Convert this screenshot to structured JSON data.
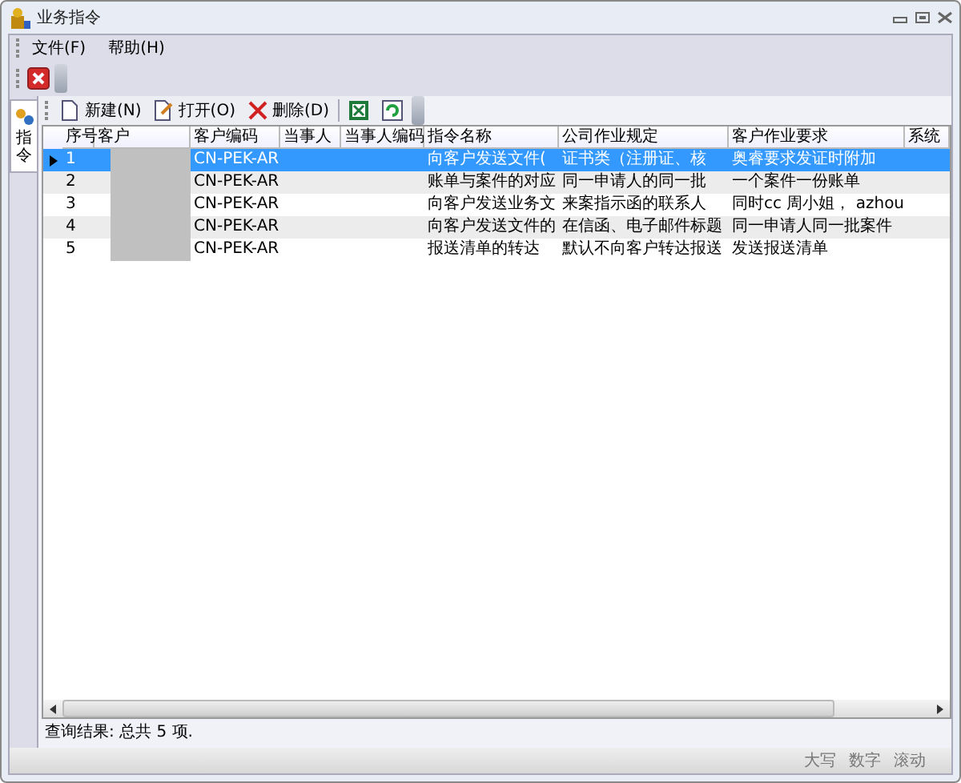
{
  "window": {
    "title": "业务指令"
  },
  "menu": [
    {
      "label": "文件(F)"
    },
    {
      "label": "帮助(H)"
    }
  ],
  "side_tab": {
    "label": "指令",
    "selected": true
  },
  "toolbar": [
    {
      "kind": "button",
      "label": "新建(N)"
    },
    {
      "kind": "button",
      "label": "打开(O)"
    },
    {
      "kind": "button",
      "label": "删除(D)"
    },
    {
      "kind": "separator"
    },
    {
      "kind": "icon_button"
    },
    {
      "kind": "icon_button"
    }
  ],
  "table": {
    "columns": [
      "序号",
      "客户",
      "客户编码",
      "当事人",
      "当事人编码",
      "指令名称",
      "公司作业规定",
      "客户作业要求",
      "系统"
    ],
    "rows": [
      {
        "selected": true,
        "current": true,
        "cells": [
          "1",
          "",
          "CN-PEK-AR",
          "",
          "",
          "向客户发送文件(",
          "证书类（注册证、核",
          "奥睿要求发证时附加",
          ""
        ]
      },
      {
        "selected": false,
        "current": false,
        "cells": [
          "2",
          "",
          "CN-PEK-AR",
          "",
          "",
          "账单与案件的对应",
          "同一申请人的同一批",
          "一个案件一份账单",
          ""
        ]
      },
      {
        "selected": false,
        "current": false,
        "cells": [
          "3",
          "",
          "CN-PEK-AR",
          "",
          "",
          "向客户发送业务文",
          "来案指示函的联系人",
          "同时cc 周小姐， azhou",
          ""
        ]
      },
      {
        "selected": false,
        "current": false,
        "cells": [
          "4",
          "",
          "CN-PEK-AR",
          "",
          "",
          "向客户发送文件的",
          "在信函、电子邮件标题",
          "同一申请人同一批案件",
          ""
        ]
      },
      {
        "selected": false,
        "current": false,
        "cells": [
          "5",
          "",
          "CN-PEK-AR",
          "",
          "",
          "报送清单的转达",
          "默认不向客户转达报送",
          "发送报送清单",
          ""
        ]
      }
    ]
  },
  "result": "查询结果: 总共 5 项.",
  "status_bar": [
    "大写",
    "数字",
    "滚动"
  ]
}
